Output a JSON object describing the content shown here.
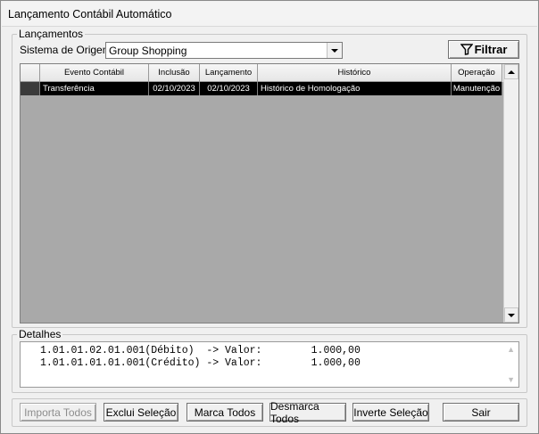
{
  "window": {
    "title": "Lançamento Contábil Automático"
  },
  "lancamentos": {
    "legend": "Lançamentos",
    "origin_label": "Sistema de Origem:",
    "origin_value": "Group Shopping",
    "filter_button": "Filtrar"
  },
  "grid": {
    "columns": [
      "Evento Contábil",
      "Inclusão",
      "Lançamento",
      "Histórico",
      "Operação"
    ],
    "rows": [
      [
        "Transferência",
        "02/10/2023",
        "02/10/2023",
        "Histórico de Homologação",
        "Manutenção"
      ]
    ]
  },
  "detalhes": {
    "legend": "Detalhes",
    "lines": [
      "1.01.01.02.01.001(Débito)  -> Valor:        1.000,00",
      "1.01.01.01.01.001(Crédito) -> Valor:        1.000,00"
    ]
  },
  "buttons": {
    "importa_todos": "Importa Todos",
    "exclui_selecao": "Exclui Seleção",
    "marca_todos": "Marca Todos",
    "desmarca_todos": "Desmarca Todos",
    "inverte_selecao": "Inverte Seleção",
    "sair": "Sair"
  }
}
